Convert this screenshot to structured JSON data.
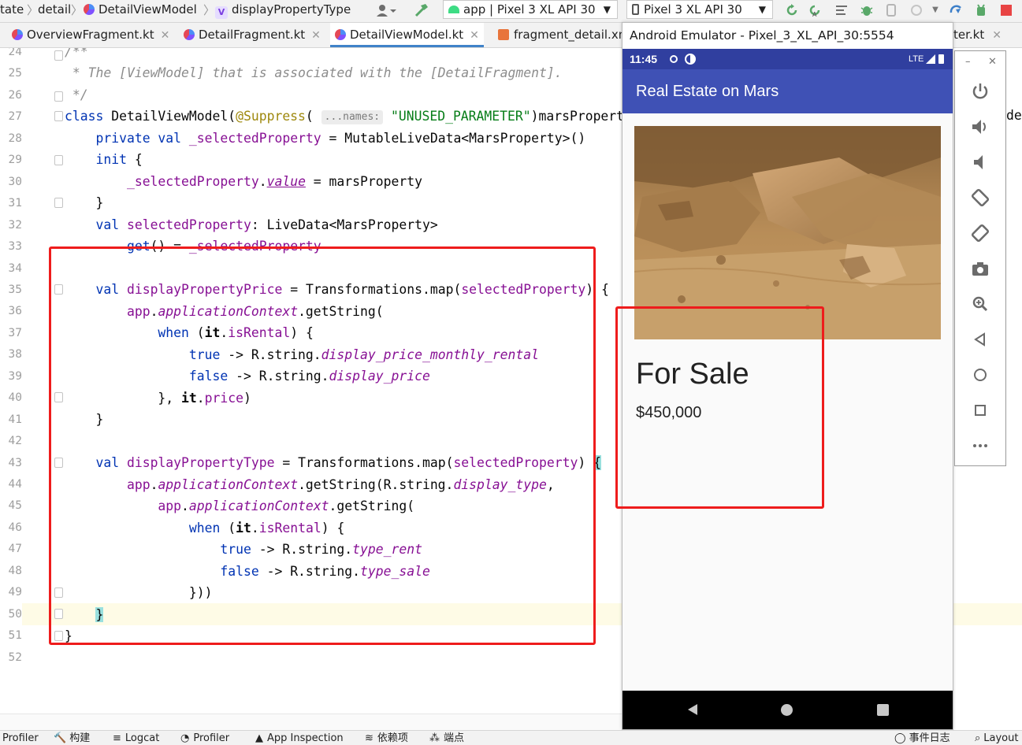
{
  "toolbar": {
    "breadcrumbs": [
      "tate",
      "detail",
      "DetailViewModel",
      "displayPropertyType"
    ],
    "run_config": "app | Pixel 3 XL API 30",
    "device": "Pixel 3 XL API 30"
  },
  "tabs": [
    {
      "label": "OverviewFragment.kt",
      "active": false
    },
    {
      "label": "DetailFragment.kt",
      "active": false
    },
    {
      "label": "DetailViewModel.kt",
      "active": true
    },
    {
      "label": "fragment_detail.xn",
      "active": false
    },
    {
      "label": "ter.kt",
      "active": false
    }
  ],
  "editor": {
    "line_numbers": [
      "24",
      "25",
      "26",
      "27",
      "28",
      "29",
      "30",
      "31",
      "32",
      "33",
      "34",
      "35",
      "36",
      "37",
      "38",
      "39",
      "40",
      "41",
      "42",
      "43",
      "44",
      "45",
      "46",
      "47",
      "48",
      "49",
      "50",
      "51",
      "52"
    ],
    "inlay_hint": "...names:",
    "right_overflow_text": "de"
  },
  "emulator": {
    "window_title": "Android Emulator - Pixel_3_XL_API_30:5554",
    "status_time": "11:45",
    "status_network": "LTE",
    "app_title": "Real Estate on Mars",
    "property_type": "For Sale",
    "property_price": "$450,000"
  },
  "bottombar": {
    "items": [
      "Profiler",
      "构建",
      "Logcat",
      "Profiler",
      "App Inspection",
      "依赖项",
      "端点",
      "事件日志",
      "Layout"
    ]
  },
  "colors": {
    "app_bar": "#3f51b5",
    "status_bar": "#303f9f",
    "annotation_red": "#ee1c1c",
    "keyword_blue": "#0033b3",
    "property_purple": "#871094",
    "string_green": "#067d17"
  }
}
